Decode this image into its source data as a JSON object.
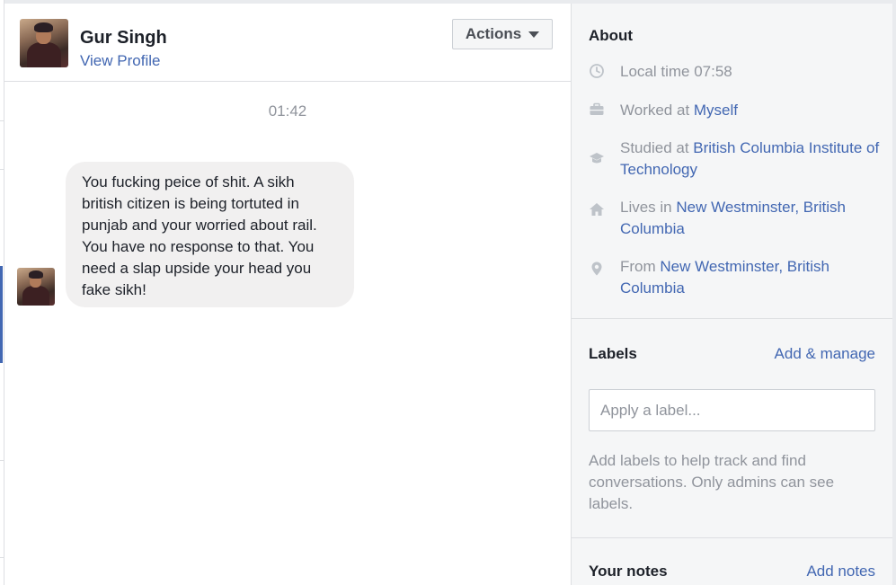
{
  "conversation": {
    "header": {
      "name": "Gur Singh",
      "profile_link": "View Profile",
      "actions_label": "Actions"
    },
    "timestamp": "01:42",
    "messages": [
      {
        "text": "You fucking peice of shit. A sikh british citizen is being tortuted in punjab and your worried about rail. You have no response to that. You need a slap upside your head you fake sikh!"
      }
    ]
  },
  "about": {
    "title": "About",
    "local_time": "Local time 07:58",
    "worked": {
      "prefix": "Worked at ",
      "link": "Myself"
    },
    "studied": {
      "prefix": "Studied at ",
      "link": "British Columbia Institute of Technology"
    },
    "lives": {
      "prefix": "Lives in ",
      "link": "New Westminster, British Columbia"
    },
    "from": {
      "prefix": "From ",
      "link": "New Westminster, British Columbia"
    }
  },
  "labels": {
    "title": "Labels",
    "add_manage": "Add & manage",
    "input_placeholder": "Apply a label...",
    "help_text": "Add labels to help track and find conversations. Only admins can see labels."
  },
  "notes": {
    "title": "Your notes",
    "add_notes": "Add notes"
  },
  "colors": {
    "link": "#4267b2",
    "muted_text": "#90949c",
    "bubble": "#f1f0f0",
    "panel_bg": "#f5f6f7"
  },
  "icons": [
    "clock-icon",
    "briefcase-icon",
    "graduation-cap-icon",
    "home-icon",
    "location-pin-icon",
    "caret-down-icon"
  ]
}
